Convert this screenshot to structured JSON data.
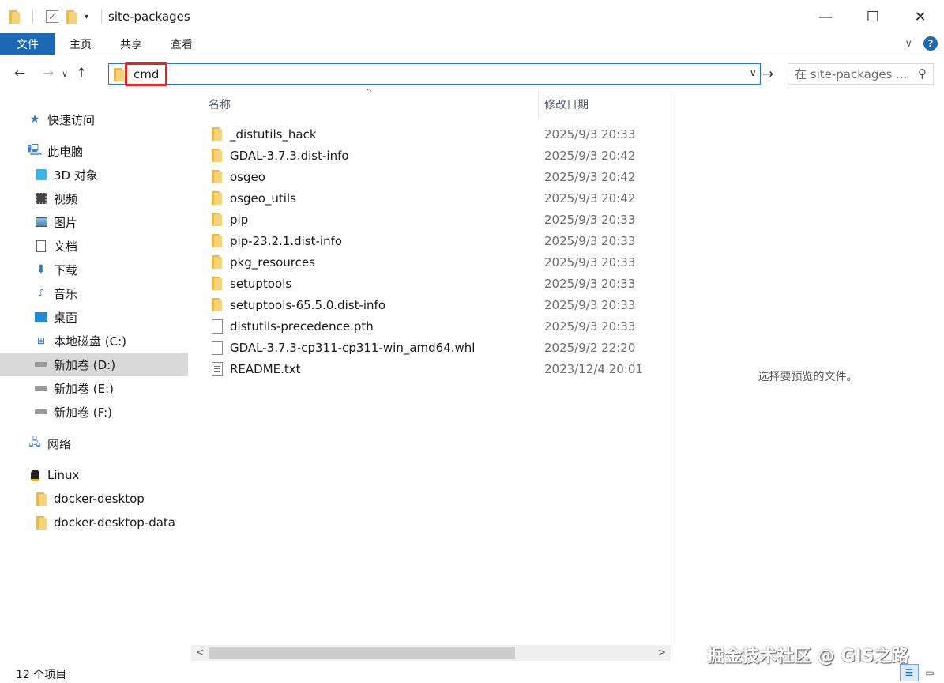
{
  "window": {
    "title": "site-packages",
    "minimize": "—",
    "maximize": "☐",
    "close": "✕"
  },
  "ribbon": {
    "tabs": [
      "文件",
      "主页",
      "共享",
      "查看"
    ],
    "expand": "∨",
    "help": "?"
  },
  "address": {
    "value": "cmd",
    "dropdown": "∨",
    "go": "→",
    "search_placeholder": "在 site-packages ...",
    "search_icon": "search-icon"
  },
  "nav": {
    "back": "←",
    "forward": "→",
    "recent": "∨",
    "up": "↑"
  },
  "sidebar": {
    "items": [
      {
        "label": "快速访问",
        "icon": "star-icon",
        "selected": false
      },
      {
        "label": "此电脑",
        "icon": "computer-icon",
        "selected": false
      },
      {
        "label": "3D 对象",
        "icon": "3d-objects-icon",
        "selected": false
      },
      {
        "label": "视频",
        "icon": "video-icon",
        "selected": false
      },
      {
        "label": "图片",
        "icon": "pictures-icon",
        "selected": false
      },
      {
        "label": "文档",
        "icon": "documents-icon",
        "selected": false
      },
      {
        "label": "下载",
        "icon": "download-icon",
        "selected": false
      },
      {
        "label": "音乐",
        "icon": "music-icon",
        "selected": false
      },
      {
        "label": "桌面",
        "icon": "desktop-icon",
        "selected": false
      },
      {
        "label": "本地磁盘 (C:)",
        "icon": "drive-windows-icon",
        "selected": false
      },
      {
        "label": "新加卷 (D:)",
        "icon": "drive-icon",
        "selected": true
      },
      {
        "label": "新加卷 (E:)",
        "icon": "drive-icon",
        "selected": false
      },
      {
        "label": "新加卷 (F:)",
        "icon": "drive-icon",
        "selected": false
      },
      {
        "label": "网络",
        "icon": "network-icon",
        "selected": false
      },
      {
        "label": "Linux",
        "icon": "linux-penguin-icon",
        "selected": false
      },
      {
        "label": "docker-desktop",
        "icon": "network-drive-icon",
        "selected": false
      },
      {
        "label": "docker-desktop-data",
        "icon": "network-drive-icon",
        "selected": false
      }
    ]
  },
  "columns": {
    "name": "名称",
    "modified": "修改日期",
    "sort": "^"
  },
  "files": [
    {
      "name": "_distutils_hack",
      "date": "2025/9/3 20:33",
      "type": "folder"
    },
    {
      "name": "GDAL-3.7.3.dist-info",
      "date": "2025/9/3 20:42",
      "type": "folder"
    },
    {
      "name": "osgeo",
      "date": "2025/9/3 20:42",
      "type": "folder"
    },
    {
      "name": "osgeo_utils",
      "date": "2025/9/3 20:42",
      "type": "folder"
    },
    {
      "name": "pip",
      "date": "2025/9/3 20:33",
      "type": "folder"
    },
    {
      "name": "pip-23.2.1.dist-info",
      "date": "2025/9/3 20:33",
      "type": "folder"
    },
    {
      "name": "pkg_resources",
      "date": "2025/9/3 20:33",
      "type": "folder"
    },
    {
      "name": "setuptools",
      "date": "2025/9/3 20:33",
      "type": "folder"
    },
    {
      "name": "setuptools-65.5.0.dist-info",
      "date": "2025/9/3 20:33",
      "type": "folder"
    },
    {
      "name": "distutils-precedence.pth",
      "date": "2025/9/3 20:33",
      "type": "file"
    },
    {
      "name": "GDAL-3.7.3-cp311-cp311-win_amd64.whl",
      "date": "2025/9/2 22:20",
      "type": "file"
    },
    {
      "name": "README.txt",
      "date": "2023/12/4 20:01",
      "type": "txt"
    }
  ],
  "preview": {
    "text": "选择要预览的文件。"
  },
  "status": {
    "count": "12 个项目"
  },
  "watermark": "掘金技术社区 @ GIS之路",
  "colors": {
    "accent": "#1c67b3",
    "highlight": "#e12424",
    "selected": "#d9d9d9"
  }
}
